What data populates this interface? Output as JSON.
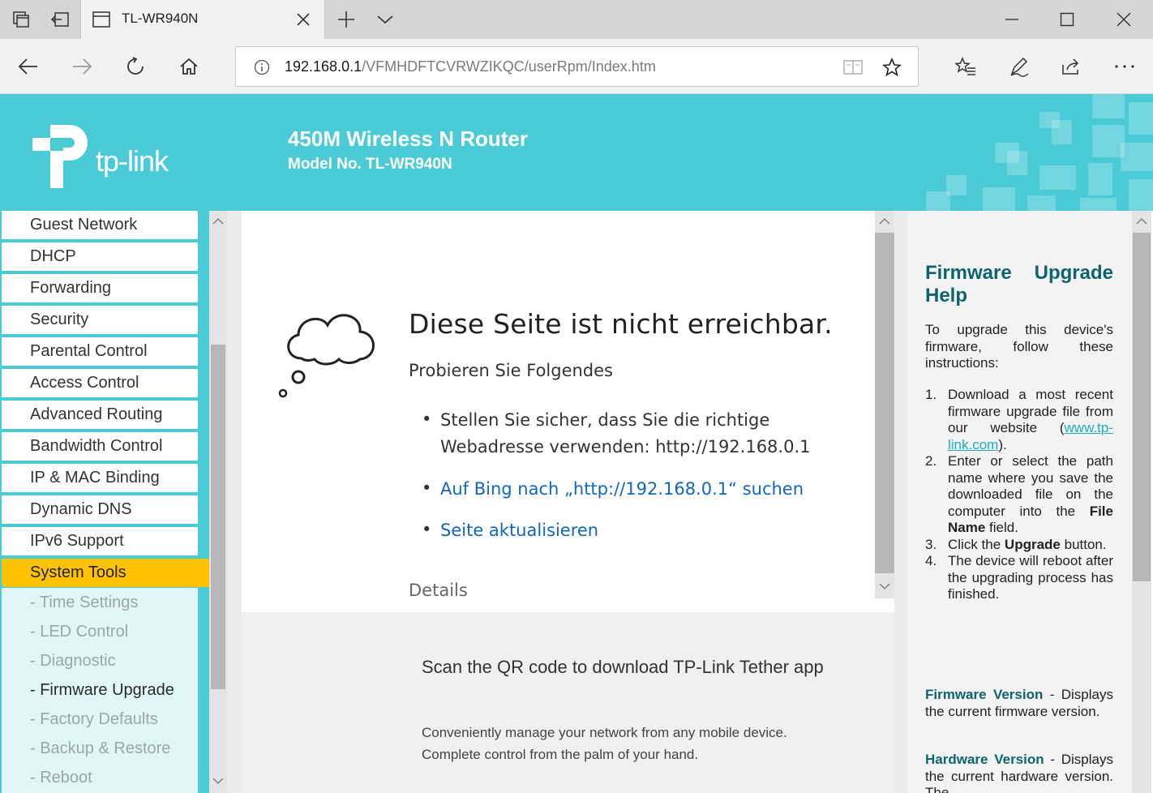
{
  "browser": {
    "tab_title": "TL-WR940N",
    "url_host": "192.168.0.1",
    "url_path": "/VFMHDFTCVRWZIKQC/userRpm/Index.htm"
  },
  "header": {
    "logo_text": "tp-link",
    "title": "450M Wireless N Router",
    "model": "Model No. TL-WR940N",
    "brand_color": "#4acbd6"
  },
  "menu": {
    "items": [
      {
        "label": "Guest Network"
      },
      {
        "label": "DHCP"
      },
      {
        "label": "Forwarding"
      },
      {
        "label": "Security"
      },
      {
        "label": "Parental Control"
      },
      {
        "label": "Access Control"
      },
      {
        "label": "Advanced Routing"
      },
      {
        "label": "Bandwidth Control"
      },
      {
        "label": "IP & MAC Binding"
      },
      {
        "label": "Dynamic DNS"
      },
      {
        "label": "IPv6 Support"
      },
      {
        "label": "System Tools"
      }
    ],
    "sub_items": [
      {
        "label": "- Time Settings"
      },
      {
        "label": "- LED Control"
      },
      {
        "label": "- Diagnostic"
      },
      {
        "label": "- Firmware Upgrade"
      },
      {
        "label": "- Factory Defaults"
      },
      {
        "label": "- Backup & Restore"
      },
      {
        "label": "- Reboot"
      }
    ],
    "active_color": "#ffc200"
  },
  "error_page": {
    "title": "Diese Seite ist nicht erreichbar.",
    "subtitle": "Probieren Sie Folgendes",
    "bullet1_line1": "Stellen Sie sicher, dass Sie die richtige",
    "bullet1_line2": "Webadresse verwenden: http://192.168.0.1",
    "bullet2": "Auf Bing nach „http://192.168.0.1“ suchen",
    "bullet3": "Seite aktualisieren",
    "details": "Details",
    "qr_title": "Scan the QR code to download TP-Link Tether app",
    "qr_desc": "Conveniently manage your network from any mobile device. Complete control from the palm of your hand."
  },
  "help": {
    "title_line1": "Firmware Upgrade",
    "title_line2": "Help",
    "intro": "To upgrade this device's firmware, follow these instructions:",
    "step1_a": "Download a most recent firmware upgrade file from our website (",
    "step1_link": "www.tp-link.com",
    "step1_b": ").",
    "step2_a": "Enter or select the path name where you save the downloaded file on the computer into the ",
    "step2_bold": "File Name",
    "step2_b": " field.",
    "step3_a": "Click the ",
    "step3_bold": "Upgrade",
    "step3_b": " button.",
    "step4": "The device will reboot after the upgrading process has finished.",
    "fw_label": "Firmware Version",
    "fw_text": " - Displays the current firmware version.",
    "hw_label": "Hardware Version",
    "hw_text": " - Displays the current hardware version. The"
  }
}
